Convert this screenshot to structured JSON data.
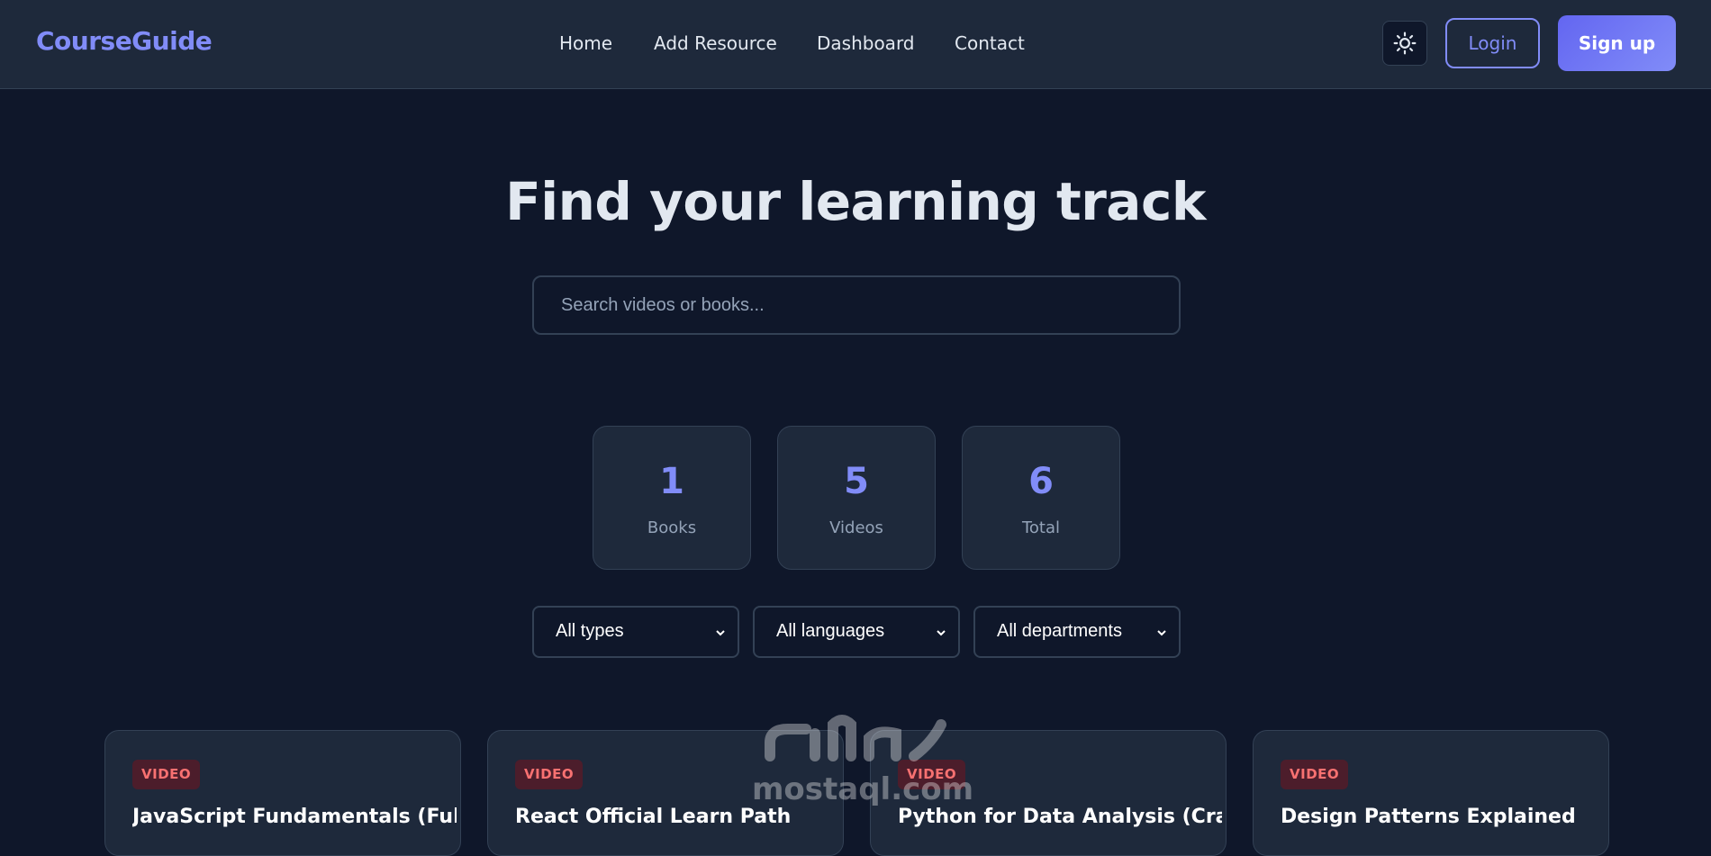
{
  "nav": {
    "brand": "CourseGuide",
    "links": [
      "Home",
      "Add Resource",
      "Dashboard",
      "Contact"
    ],
    "login_label": "Login",
    "signup_label": "Sign up",
    "theme_icon": "sun-icon"
  },
  "hero": {
    "title": "Find your learning track",
    "search_placeholder": "Search videos or books..."
  },
  "stats": [
    {
      "value": "1",
      "label": "Books"
    },
    {
      "value": "5",
      "label": "Videos"
    },
    {
      "value": "6",
      "label": "Total"
    }
  ],
  "filters": [
    {
      "selected": "All types"
    },
    {
      "selected": "All languages"
    },
    {
      "selected": "All departments"
    }
  ],
  "cards": [
    {
      "badge": "VIDEO",
      "title": "JavaScript Fundamentals (Full"
    },
    {
      "badge": "VIDEO",
      "title": "React Official Learn Path"
    },
    {
      "badge": "VIDEO",
      "title": "Python for Data Analysis (Crash"
    },
    {
      "badge": "VIDEO",
      "title": "Design Patterns Explained"
    }
  ],
  "watermark": {
    "text": "mostaql.com",
    "logo_text": "مستقل"
  },
  "colors": {
    "accent": "#818cf8",
    "background": "#0f172a",
    "surface": "#1e293b",
    "badge_text": "#f87171"
  }
}
